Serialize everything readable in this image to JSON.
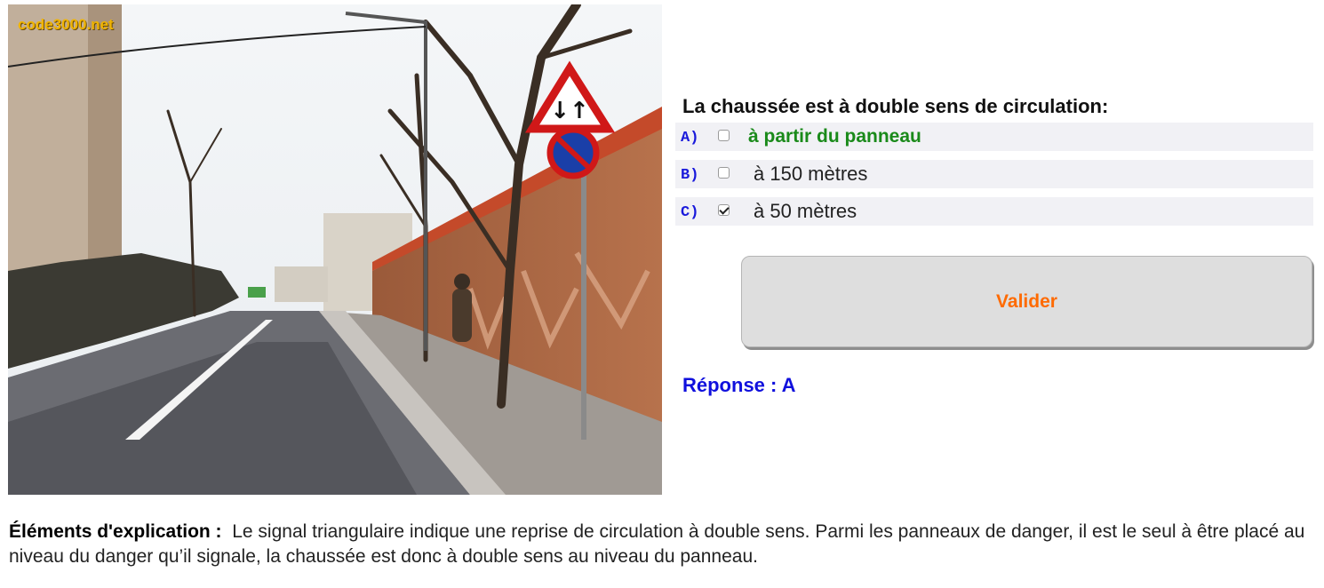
{
  "image": {
    "watermark": "code3000.net",
    "signs": [
      "two-way-traffic-warning-sign",
      "no-parking-sign"
    ]
  },
  "question": {
    "text": "La chaussée est à double sens de circulation:",
    "answers": [
      {
        "letter": "A)",
        "text": "à partir du panneau",
        "checked": false,
        "correct": true
      },
      {
        "letter": "B)",
        "text": "à 150 mètres",
        "checked": false,
        "correct": false
      },
      {
        "letter": "C)",
        "text": "à 50 mètres",
        "checked": true,
        "correct": false
      }
    ]
  },
  "actions": {
    "valider_label": "Valider"
  },
  "result": {
    "reponse": "Réponse : A"
  },
  "explication": {
    "label": "Éléments d'explication :",
    "text": "Le signal triangulaire indique une reprise de circulation à double sens. Parmi les panneaux de danger, il est le seul à être placé au niveau du danger qu’il signale, la chaussée est donc à double sens au niveau du panneau."
  },
  "colors": {
    "answer_letter": "#1a1adb",
    "correct_answer": "#1a8a1a",
    "valider_text": "#ff6a00",
    "reponse": "#1010dd",
    "watermark": "#f0b400"
  }
}
